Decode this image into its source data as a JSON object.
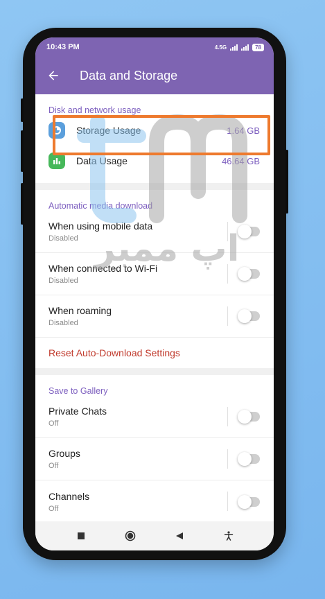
{
  "status_bar": {
    "time": "10:43 PM",
    "network": "4.5G",
    "battery": "78"
  },
  "app_bar": {
    "title": "Data and Storage"
  },
  "disk_section": {
    "header": "Disk and network usage",
    "items": [
      {
        "label": "Storage Usage",
        "value": "1.64 GB",
        "icon": "storage-icon",
        "icon_color": "#5b9fdc"
      },
      {
        "label": "Data Usage",
        "value": "46.64 GB",
        "icon": "bar-chart-icon",
        "icon_color": "#46b85a"
      }
    ]
  },
  "auto_download": {
    "header": "Automatic media download",
    "items": [
      {
        "label": "When using mobile data",
        "sub": "Disabled",
        "enabled": false
      },
      {
        "label": "When connected to Wi-Fi",
        "sub": "Disabled",
        "enabled": false
      },
      {
        "label": "When roaming",
        "sub": "Disabled",
        "enabled": false
      }
    ],
    "reset_label": "Reset Auto-Download Settings"
  },
  "save_to_gallery": {
    "header": "Save to Gallery",
    "items": [
      {
        "label": "Private Chats",
        "sub": "Off",
        "enabled": false
      },
      {
        "label": "Groups",
        "sub": "Off",
        "enabled": false
      },
      {
        "label": "Channels",
        "sub": "Off",
        "enabled": false
      }
    ]
  },
  "nav_bar": {
    "buttons": [
      "recents-icon",
      "home-icon",
      "back-icon",
      "accessibility-icon"
    ]
  },
  "colors": {
    "accent": "#7e64b2",
    "highlight": "#ee7a2e",
    "reset": "#c0392b"
  },
  "watermark": {
    "text": "اپ ممبر"
  }
}
